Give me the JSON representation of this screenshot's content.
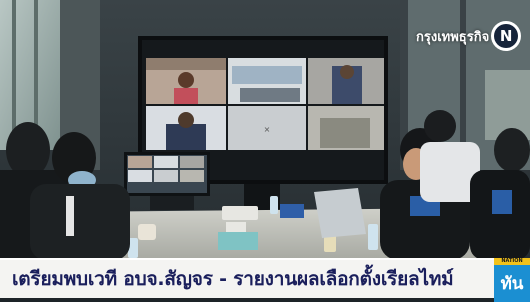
{
  "video": {
    "ticker_headline": "เตรียมพบเวที อบจ.สัญจร - รายงานผลเลือกตั้งเรียลไทม์",
    "channel_bug_text": "กรุงเทพธุรกิจ",
    "channel_logo_letter": "N",
    "program_logo_top": "NATION",
    "program_logo_text": "ทัน"
  },
  "scene": {
    "description_colors": {
      "wall": "#2a3238",
      "ticker_text": "#1a1f5c",
      "program_logo": "#1b8fd2"
    }
  }
}
